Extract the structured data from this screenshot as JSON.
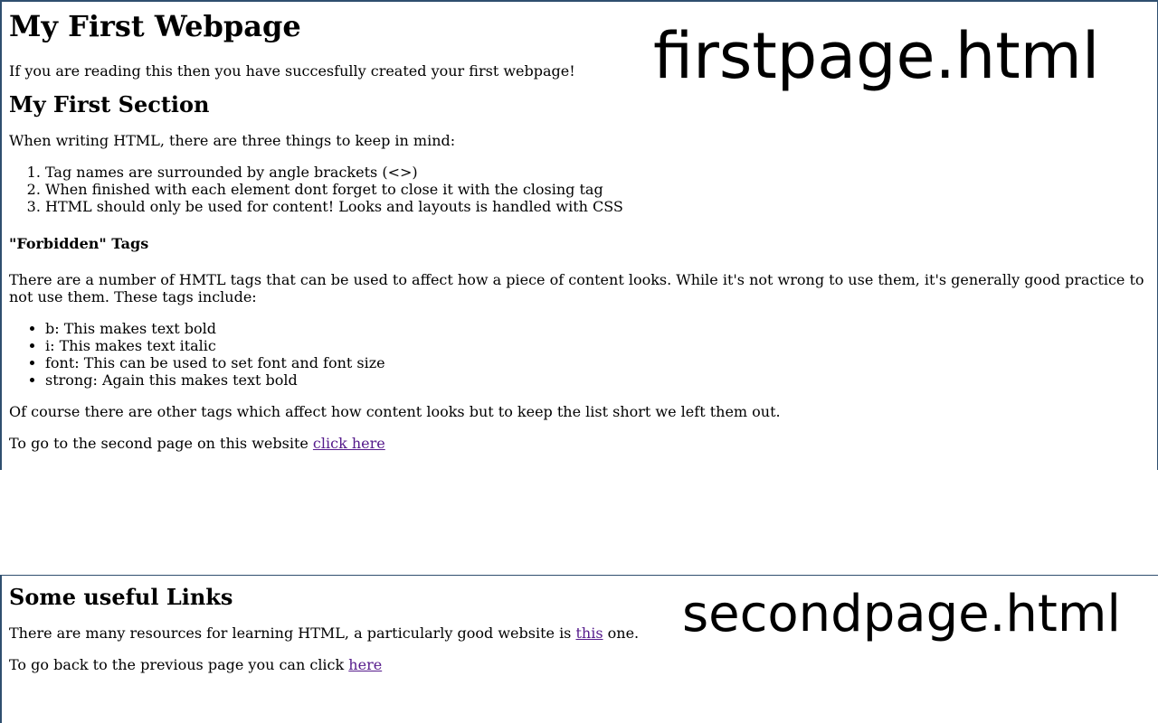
{
  "first_page": {
    "filename_label": "firstpage.html",
    "title": "My First Webpage",
    "intro": "If you are reading this then you have succesfully created your first webpage!",
    "section_heading": "My First Section",
    "section_intro": "When writing HTML, there are three things to keep in mind:",
    "rules": [
      "Tag names are surrounded by angle brackets (<>)",
      "When finished with each element dont forget to close it with the closing tag",
      "HTML should only be used for content! Looks and layouts is handled with CSS"
    ],
    "forbidden_heading": "\"Forbidden\" Tags",
    "forbidden_intro": "There are a number of HMTL tags that can be used to affect how a piece of content looks. While it's not wrong to use them, it's generally good practice to not use them. These tags include:",
    "forbidden_tags": [
      "b: This makes text bold",
      "i: This makes text italic",
      "font: This can be used to set font and font size",
      "strong: Again this makes text bold"
    ],
    "closing_note": "Of course there are other tags which affect how content looks but to keep the list short we left them out.",
    "next_text": "To go to the second page on this website ",
    "next_link": "click here"
  },
  "second_page": {
    "filename_label": "secondpage.html",
    "title": "Some useful Links",
    "resources_text_before": "There are many resources for learning HTML, a particularly good website is ",
    "resources_link": "this",
    "resources_text_after": " one.",
    "back_text": "To go back to the previous page you can click ",
    "back_link": "here"
  },
  "colors": {
    "link_visited": "#551a8b",
    "frame_border": "#2f4f6f"
  }
}
